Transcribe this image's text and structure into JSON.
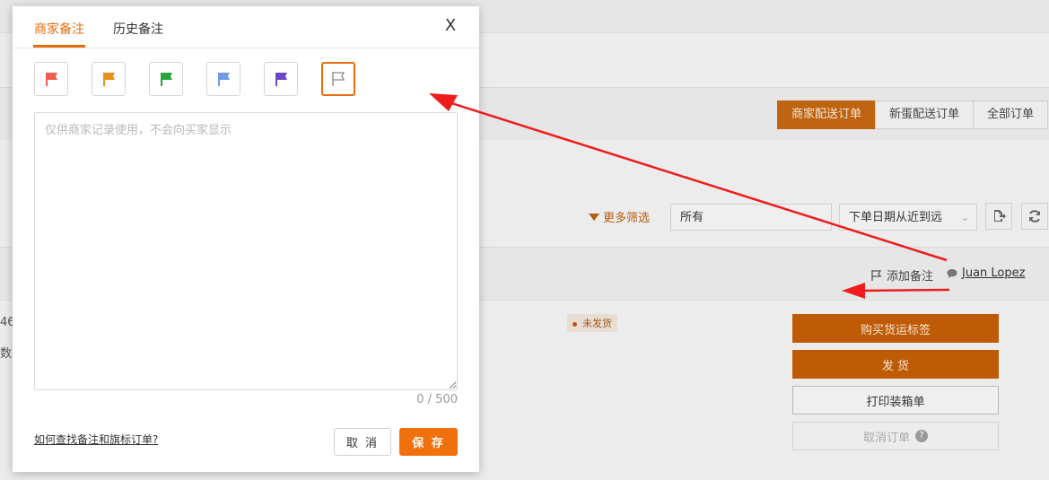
{
  "modal": {
    "tabs": [
      {
        "label": "商家备注",
        "active": true
      },
      {
        "label": "历史备注",
        "active": false
      }
    ],
    "close_label": "X",
    "flags": [
      {
        "name": "red-flag",
        "color": "#f05b55"
      },
      {
        "name": "orange-flag",
        "color": "#e8901a"
      },
      {
        "name": "green-flag",
        "color": "#2aa43c"
      },
      {
        "name": "blue-flag",
        "color": "#6f9be6"
      },
      {
        "name": "purple-flag",
        "color": "#6a48c9"
      },
      {
        "name": "no-flag",
        "color": "#888888",
        "selected": true
      }
    ],
    "textarea": {
      "value": "",
      "placeholder": "仅供商家记录使用，不会向买家显示"
    },
    "counter": "0 / 500",
    "help_link": "如何查找备注和旗标订单?",
    "cancel_label": "取 消",
    "save_label": "保 存",
    "accent_color": "#f0700d"
  },
  "background": {
    "tabs": [
      {
        "label": "商家配送订单",
        "active": true
      },
      {
        "label": "新蛋配送订单",
        "active": false
      },
      {
        "label": "全部订单",
        "active": false
      }
    ],
    "more_filters": "更多筛选",
    "status_select": "所有",
    "sort_select": "下单日期从近到远",
    "add_note": "添加备注",
    "customer_name": "Juan Lopez",
    "status_badge": "未发货",
    "buttons": {
      "buy_label": "购买货运标签",
      "ship": "发 货",
      "print_packing": "打印装箱单",
      "cancel_order": "取消订单"
    },
    "left_fragments": [
      "46",
      "数"
    ]
  }
}
